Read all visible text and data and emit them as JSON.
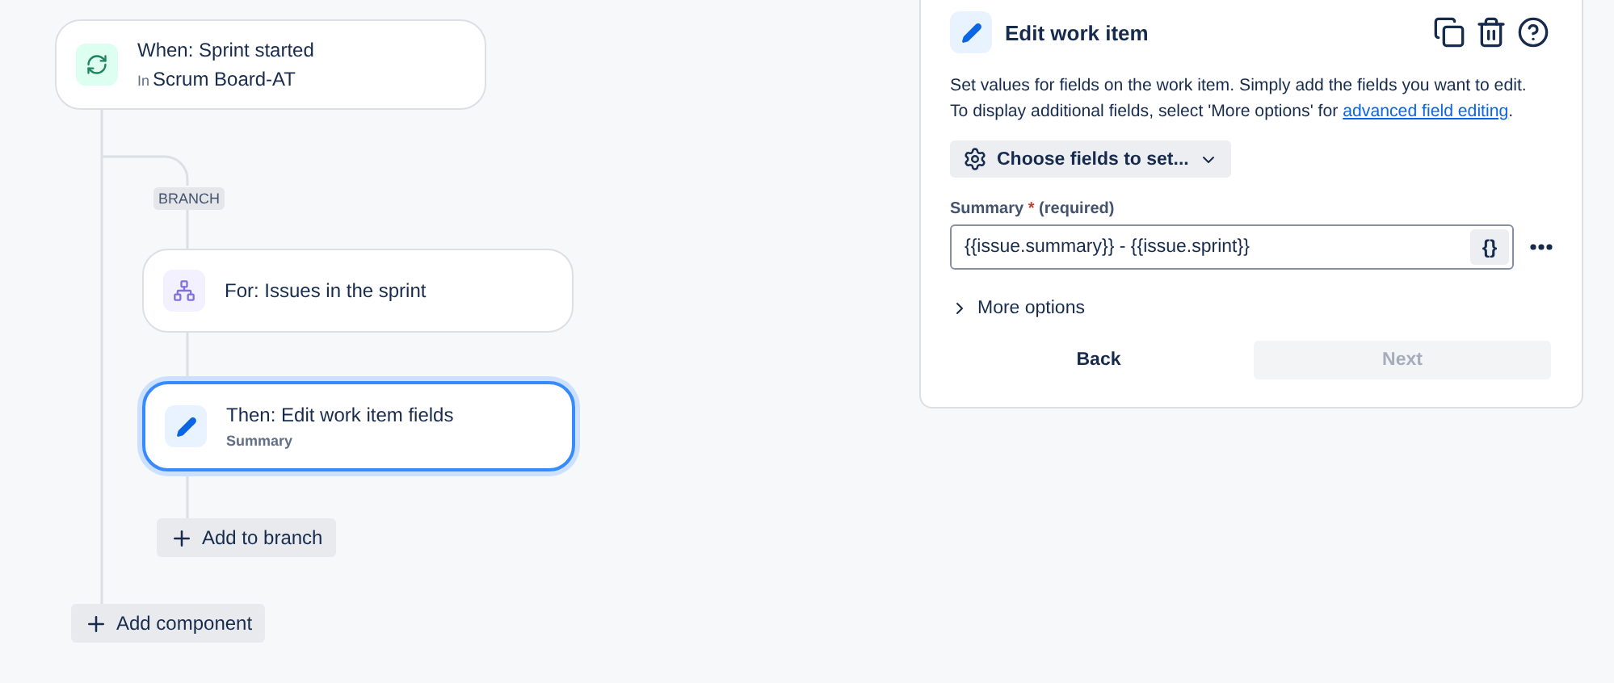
{
  "flow": {
    "trigger": {
      "title": "When: Sprint started",
      "prefix": "In",
      "board": "Scrum Board-AT"
    },
    "branch_label": "BRANCH",
    "nodes": [
      {
        "kind": "branch",
        "title": "For: Issues in the sprint",
        "selected": false
      },
      {
        "kind": "edit",
        "title": "Then: Edit work item fields",
        "subtitle": "Summary",
        "selected": true
      }
    ],
    "add_to_branch": "Add to branch",
    "add_component": "Add component"
  },
  "panel": {
    "title": "Edit work item",
    "description": {
      "lines": [
        "Set values for fields on the work item. Simply add the fields you want to edit.",
        "To display additional fields, select 'More options' for"
      ],
      "link": "advanced field editing",
      "after": "."
    },
    "choose_fields": "Choose fields to set...",
    "field": {
      "label": "Summary",
      "required_mark": "*",
      "required_note": "(required)",
      "value": "{{issue.summary}} - {{issue.sprint}}",
      "smart_button": "{}"
    },
    "more_options": {
      "label": "More options",
      "expanded": false
    },
    "buttons": [
      {
        "label": "Back",
        "disabled": false
      },
      {
        "label": "Next",
        "disabled": true
      }
    ]
  }
}
